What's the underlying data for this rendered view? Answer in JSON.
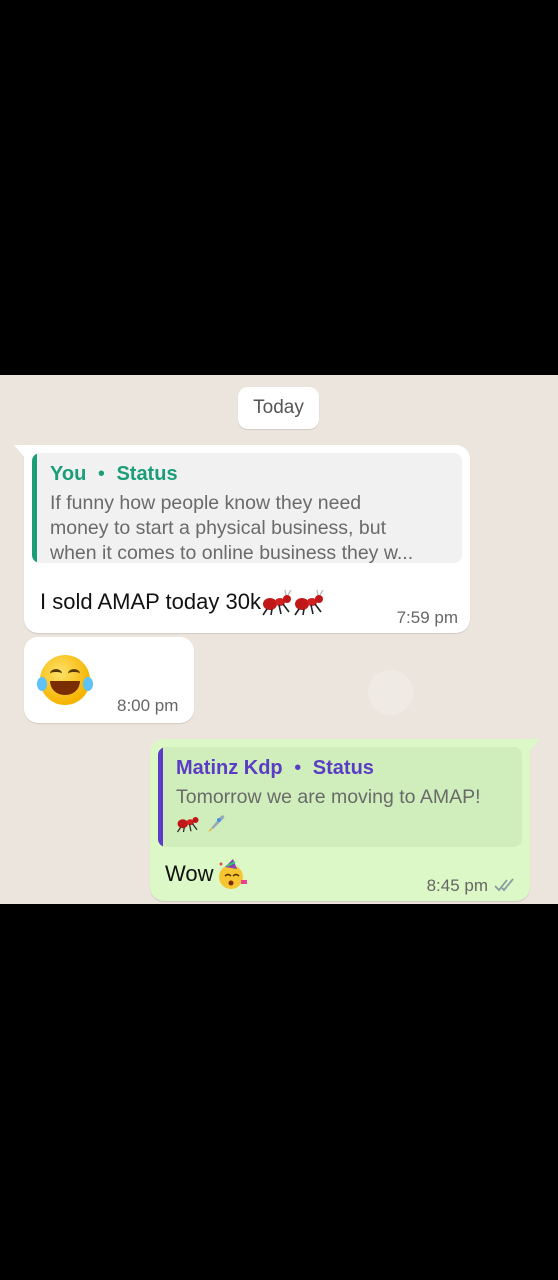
{
  "date_pill": "Today",
  "messages": [
    {
      "direction": "incoming",
      "reply_to": {
        "sender": "You",
        "source": "Status",
        "separator": "•",
        "text_lines": [
          "If funny how people know they need",
          "money to start a physical business, but",
          "when it comes to online business they w..."
        ]
      },
      "text": "I sold AMAP today 30k",
      "time": "7:59 pm"
    },
    {
      "direction": "incoming",
      "emoji_name": "face-with-tears-of-joy",
      "time": "8:00 pm"
    },
    {
      "direction": "outgoing",
      "reply_to": {
        "sender": "Matinz Kdp",
        "source": "Status",
        "separator": "•",
        "text_lines": [
          "Tomorrow we are moving to AMAP!"
        ]
      },
      "text": "Wow",
      "time": "8:45 pm",
      "read_status": "double-check"
    }
  ],
  "colors": {
    "reply_incoming_accent": "#1b9e77",
    "reply_outgoing_accent": "#5b3cc4",
    "outgoing_bubble": "#dcf8c6",
    "chat_background": "#ece5dd"
  }
}
